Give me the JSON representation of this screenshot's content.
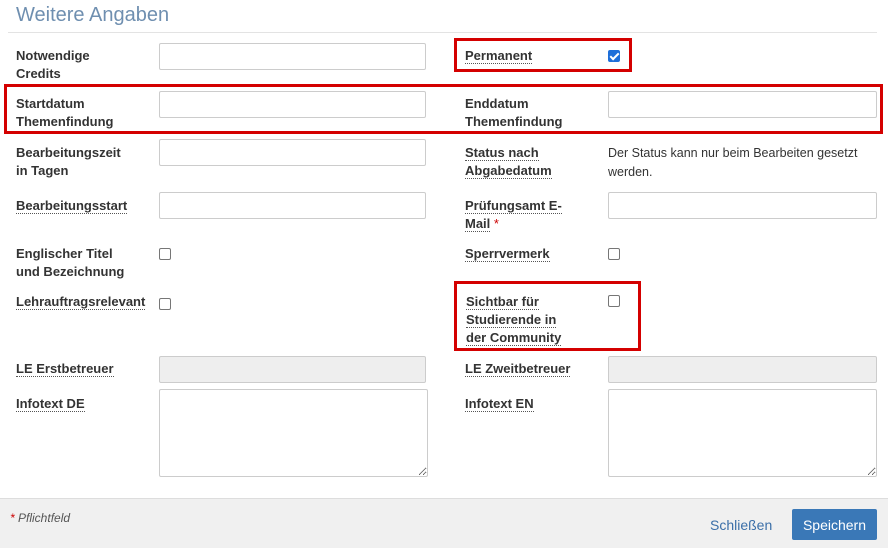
{
  "dialog": {
    "title": "Weitere Angaben"
  },
  "fields": {
    "credits_label": [
      "Notwendige",
      "Credits"
    ],
    "permanent_label": "Permanent",
    "permanent_checked": true,
    "start_label": [
      "Startdatum",
      "Themenfindung"
    ],
    "end_label": [
      "Enddatum",
      "Themenfindung"
    ],
    "bearbeitungszeit_label": [
      "Bearbeitungszeit",
      "in Tagen"
    ],
    "status_label": [
      "Status nach",
      "Abgabedatum"
    ],
    "status_text": [
      "Der Status kann nur beim Bearbeiten gesetzt",
      "werden."
    ],
    "bearbeitungsstart_label": "Bearbeitungsstart",
    "pruefungsamt_label": [
      "Prüfungsamt E-",
      "Mail"
    ],
    "required_marker": "*",
    "englischer_titel_label": [
      "Englischer Titel",
      "und Bezeichnung"
    ],
    "englischer_titel_checked": false,
    "sperrvermerk_label": "Sperrvermerk",
    "sperrvermerk_checked": false,
    "lehrauftrag_label": "Lehrauftragsrelevant",
    "lehrauftrag_checked": false,
    "sichtbar_label": [
      "Sichtbar für",
      "Studierende in",
      "der Community"
    ],
    "sichtbar_checked": false,
    "le_erst_label": "LE Erstbetreuer",
    "le_zweit_label": "LE Zweitbetreuer",
    "infotext_de_label": "Infotext DE",
    "infotext_en_label": "Infotext EN"
  },
  "footer": {
    "required_note_star": "*",
    "required_note_text": "Pflichtfeld",
    "close_label": "Schließen",
    "save_label": "Speichern"
  },
  "colors": {
    "highlight": "#d40000",
    "primary": "#3a78b7",
    "title": "#6f8fb0"
  }
}
